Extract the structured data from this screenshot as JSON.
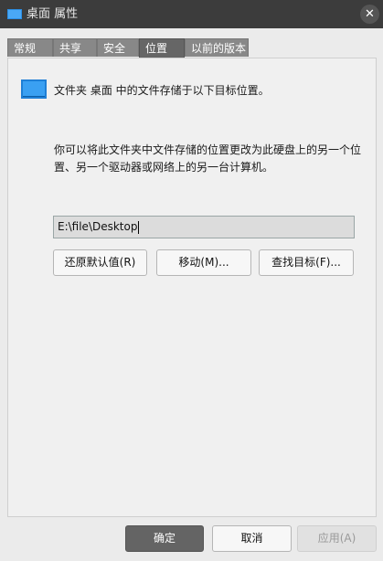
{
  "window": {
    "title": "桌面 属性",
    "close_glyph": "✕"
  },
  "tabs": [
    {
      "label": "常规"
    },
    {
      "label": "共享"
    },
    {
      "label": "安全"
    },
    {
      "label": "位置",
      "active": true
    },
    {
      "label": "以前的版本"
    }
  ],
  "location": {
    "description": "文件夹 桌面 中的文件存储于以下目标位置。",
    "move_description": "你可以将此文件夹中文件存储的位置更改为此硬盘上的另一个位置、另一个驱动器或网络上的另一台计算机。",
    "path_value": "E:\\file\\Desktop",
    "restore_default_label": "还原默认值(R)",
    "move_label": "移动(M)...",
    "find_target_label": "查找目标(F)..."
  },
  "footer": {
    "ok_label": "确定",
    "cancel_label": "取消",
    "apply_label": "应用(A)"
  },
  "colors": {
    "accent": "#2b8fe6",
    "titlebar": "#3c3c3c"
  },
  "icons": {
    "title": "folder-desktop-icon",
    "close": "close-icon",
    "folder": "folder-desktop-icon"
  }
}
